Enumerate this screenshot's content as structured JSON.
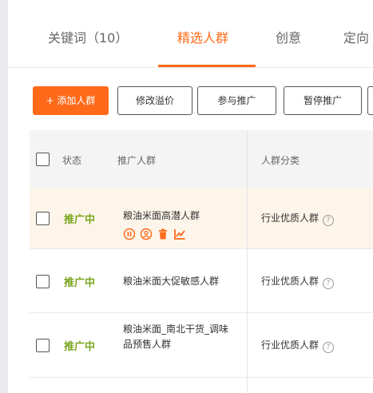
{
  "tabs": [
    {
      "label": "关键词（10）"
    },
    {
      "label": "精选人群"
    },
    {
      "label": "创意"
    },
    {
      "label": "定向"
    }
  ],
  "toolbar": {
    "add_label": "+ 添加人群",
    "modify_premium_label": "修改溢价",
    "join_promo_label": "参与推广",
    "pause_promo_label": "暂停推广"
  },
  "table": {
    "headers": {
      "status": "状态",
      "crowd": "推广人群",
      "category": "人群分类"
    },
    "rows": [
      {
        "status": "推广中",
        "name": "粮油米面高潜人群",
        "category": "行业优质人群",
        "help": "?"
      },
      {
        "status": "推广中",
        "name": "粮油米面大促敏感人群",
        "category": "行业优质人群",
        "help": "?"
      },
      {
        "status": "推广中",
        "name": "粮油米面_南北干货_调味品预售人群",
        "category": "行业优质人群",
        "help": "?"
      }
    ]
  },
  "icons": [
    "pause-icon",
    "person-icon",
    "trash-icon",
    "trend-chart-icon"
  ],
  "colors": {
    "accent": "#ff6a1a",
    "status_active": "#7aa520",
    "row_highlight": "#fdf5ea"
  }
}
